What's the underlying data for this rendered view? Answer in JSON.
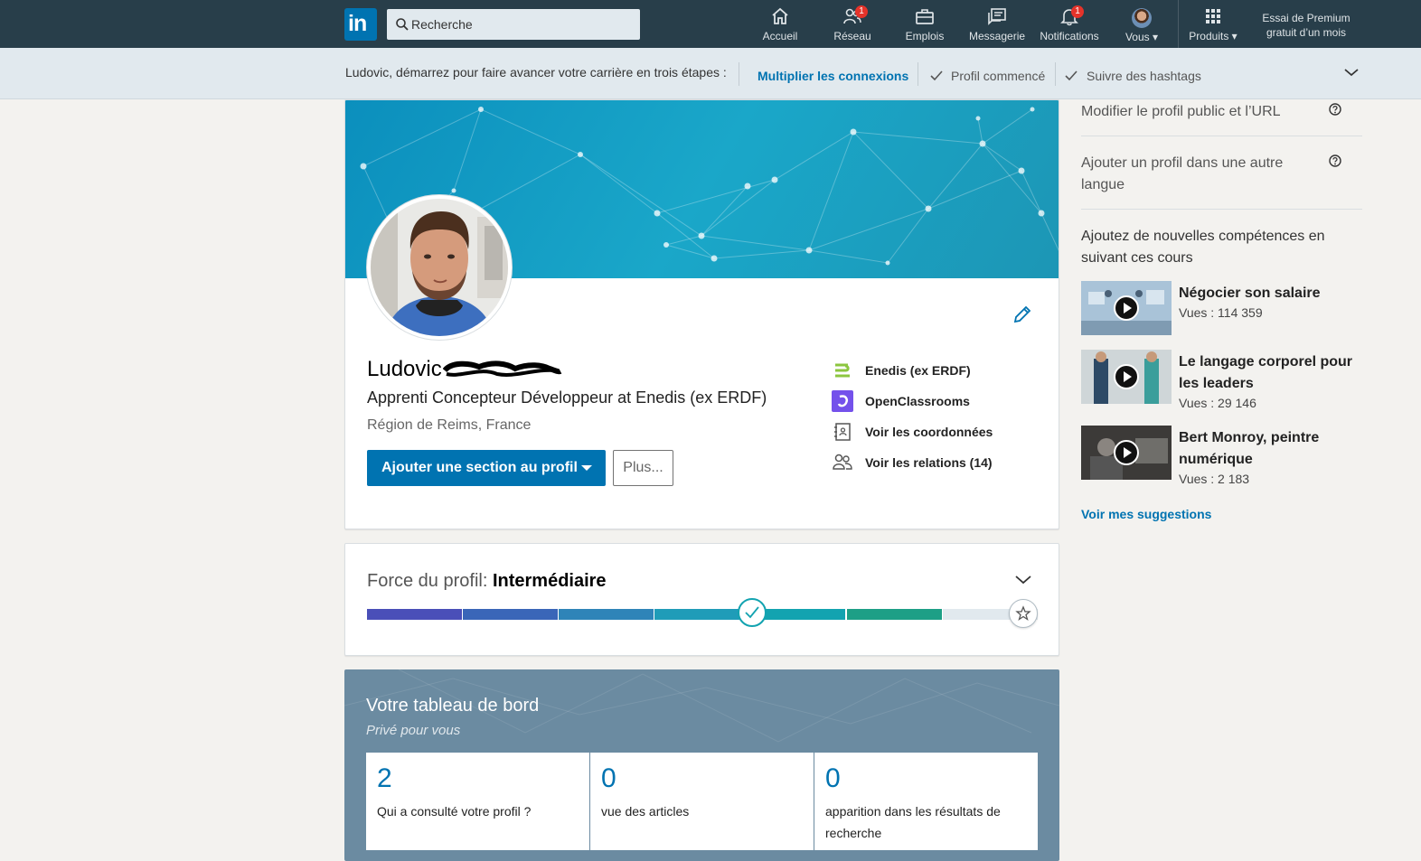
{
  "nav": {
    "search_placeholder": "Recherche",
    "items": [
      {
        "label": "Accueil",
        "icon": "home-icon"
      },
      {
        "label": "Réseau",
        "icon": "network-icon",
        "badge": "1"
      },
      {
        "label": "Emplois",
        "icon": "jobs-icon"
      },
      {
        "label": "Messagerie",
        "icon": "messaging-icon"
      },
      {
        "label": "Notifications",
        "icon": "bell-icon",
        "badge": "1"
      },
      {
        "label": "Vous",
        "icon": "avatar"
      },
      {
        "label": "Produits",
        "icon": "grid-icon"
      }
    ],
    "premium_line1": "Essai de Premium",
    "premium_line2": "gratuit d’un mois"
  },
  "onboarding": {
    "intro": "Ludovic, démarrez pour faire avancer votre carrière en trois étapes :",
    "step1": "Multiplier les connexions",
    "step2": "Profil commencé",
    "step3": "Suivre des hashtags"
  },
  "profile": {
    "first_name": "Ludovic",
    "headline": "Apprenti Concepteur Développeur at Enedis (ex ERDF)",
    "location": "Région de Reims, France",
    "add_section_button": "Ajouter une section au profil",
    "more_button": "Plus...",
    "side_links": [
      {
        "label": "Enedis (ex ERDF)",
        "icon": "enedis-logo-icon"
      },
      {
        "label": "OpenClassrooms",
        "icon": "openclassrooms-logo-icon"
      },
      {
        "label": "Voir les coordonnées",
        "icon": "contact-card-icon"
      },
      {
        "label": "Voir les relations (14)",
        "icon": "people-icon"
      }
    ]
  },
  "strength": {
    "label": "Force du profil:",
    "level": "Intermédiaire",
    "completed_segments": 5,
    "total_segments": 7
  },
  "dashboard": {
    "title": "Votre tableau de bord",
    "subtitle": "Privé pour vous",
    "stats": [
      {
        "value": "2",
        "label": "Qui a consulté votre profil ?"
      },
      {
        "value": "0",
        "label": "vue des articles"
      },
      {
        "value": "0",
        "label": "apparition dans les résultats de recherche"
      }
    ]
  },
  "rail": {
    "public_profile": "Modifier le profil public et l’URL",
    "other_language": "Ajouter un profil dans une autre langue",
    "courses_heading": "Ajoutez de nouvelles compétences en suivant ces cours",
    "courses": [
      {
        "title": "Négocier son salaire",
        "views": "Vues : 114 359"
      },
      {
        "title": "Le langage corporel pour les leaders",
        "views": "Vues : 29 146"
      },
      {
        "title": "Bert Monroy, peintre numérique",
        "views": "Vues : 2 183"
      }
    ],
    "see_suggestions": "Voir mes suggestions"
  },
  "colors": {
    "nav_bg": "#283e4a",
    "brand_blue": "#0073b1",
    "page_bg": "#f3f2ef",
    "strength_segments": [
      "#4a4fb8",
      "#3a66b8",
      "#2f84b8",
      "#1f9cb8",
      "#13a3b0",
      "#1d9f86",
      "#e1e9ee",
      "#e1e9ee"
    ]
  }
}
